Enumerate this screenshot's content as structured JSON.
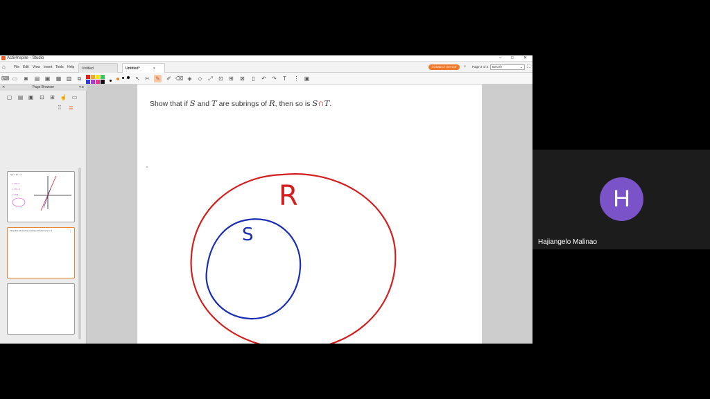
{
  "app": {
    "title": "ActivInspire - Studio",
    "window_controls": [
      "–",
      "□",
      "✕"
    ]
  },
  "menu": {
    "items": [
      "File",
      "Edit",
      "View",
      "Insert",
      "Tools",
      "Help"
    ]
  },
  "tabs": [
    {
      "label": "Untitled",
      "active": false
    },
    {
      "label": "Untitled*",
      "active": true
    }
  ],
  "header_right": {
    "connect_button": "CONNECT DEVICE",
    "page_indicator": "Page 2 of 3",
    "zoom": "Best fit"
  },
  "toolbar": {
    "colors": [
      "#e52020",
      "#f5a623",
      "#f8e71c",
      "#34c759",
      "#2d3bd8",
      "#b03ad8",
      "#e8368f",
      "#111111"
    ]
  },
  "page_browser": {
    "title": "Page Browser",
    "thumbnails": [
      {
        "text": "f(x) = 3x + 4",
        "active": false
      },
      {
        "text": "Show that if S and T are subrings of R, then so is S∩T.",
        "active": true
      },
      {
        "text": "",
        "active": false
      }
    ]
  },
  "page": {
    "problem": {
      "pre": "Show that if ",
      "S": "S",
      "and": " and ",
      "T": "T",
      "mid": " are subrings of ",
      "R": "R",
      "then": ", then so is ",
      "S2": "S",
      "intersect": "∩",
      "T2": "T",
      "end": "."
    },
    "annotations": {
      "outer_label": "R",
      "inner_label": "S",
      "outer_color": "#d41d1d",
      "inner_color": "#1a2db5"
    }
  },
  "participant": {
    "initial": "H",
    "name": "Hajiangelo Malinao",
    "avatar_color": "#7a53c8"
  }
}
